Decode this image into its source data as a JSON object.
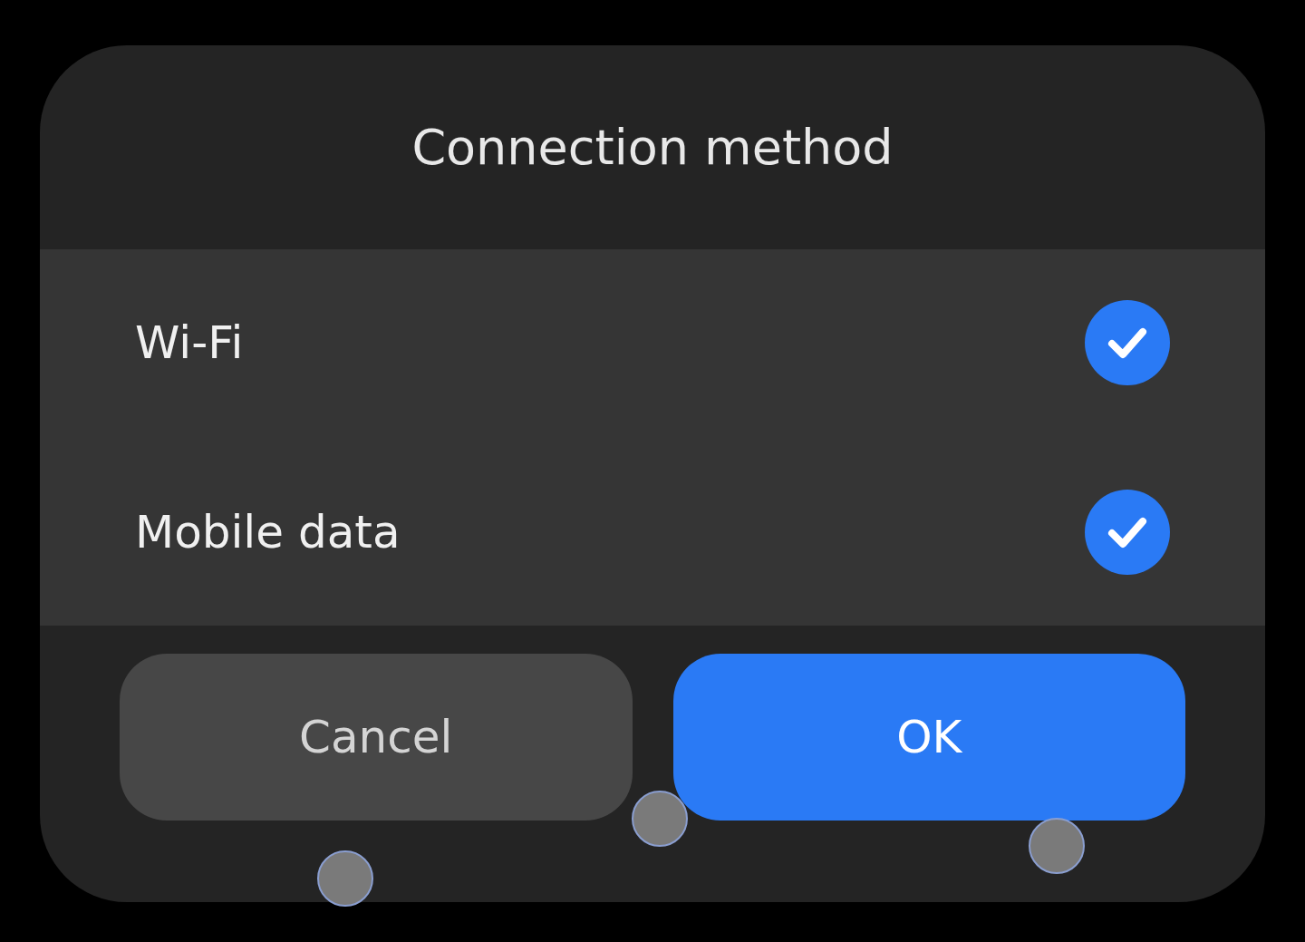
{
  "dialog": {
    "title": "Connection method",
    "options": [
      {
        "label": "Wi-Fi",
        "checked": true
      },
      {
        "label": "Mobile data",
        "checked": true
      }
    ],
    "buttons": [
      {
        "label": "Cancel",
        "kind": "secondary"
      },
      {
        "label": "OK",
        "kind": "primary"
      }
    ]
  }
}
